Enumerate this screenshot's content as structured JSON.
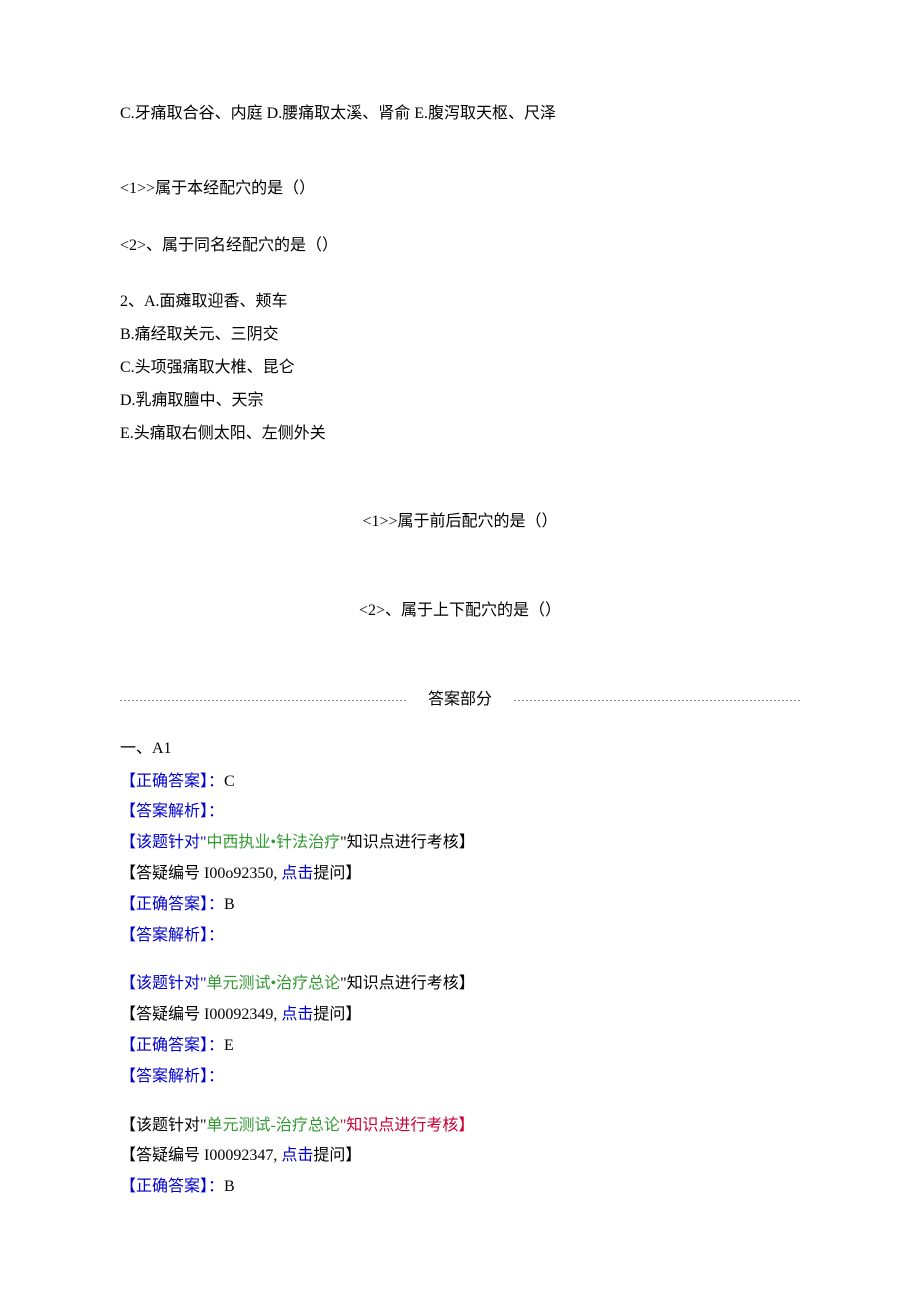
{
  "q1": {
    "optionCD_E": "C.牙痛取合谷、内庭 D.腰痛取太溪、肾俞 E.腹泻取天枢、尺泽",
    "sub1": "<1>>属于本经配穴的是（）",
    "sub2": "<2>、属于同名经配穴的是（）"
  },
  "q2": {
    "label": "2、A.面瘫取迎香、颊车",
    "optB": "B.痛经取关元、三阴交",
    "optC": "C.头项强痛取大椎、昆仑",
    "optD": "D.乳痈取膻中、天宗",
    "optE": "E.头痛取右侧太阳、左侧外关",
    "sub1": "<1>>属于前后配穴的是（）",
    "sub2": "<2>、属于上下配穴的是（）"
  },
  "answerHeader": "答案部分",
  "sectionLabel": "一、A1",
  "labels": {
    "correct_open": "【正确答案】：",
    "analysis": "【答案解析】：",
    "topic_open": "【该题针对\"",
    "topic_close": "\"知识点进行考核】",
    "qnum_open": "【答疑编号 ",
    "qnum_mid": ", ",
    "qnum_close": "提问】",
    "click": "点击"
  },
  "answers": [
    {
      "correct": "C",
      "topic": "中西执业•针法治疗",
      "qnum": "I00o92350",
      "topic_prefix_black": false
    },
    {
      "correct": "B",
      "topic": "单元测试•治疗总论",
      "qnum": "I00092349",
      "topic_prefix_black": false
    },
    {
      "correct": "E",
      "topic": "单元测试-治疗总论",
      "qnum": "I00092347",
      "topic_prefix_black": true
    },
    {
      "correct": "B",
      "topic": "",
      "qnum": "",
      "topic_prefix_black": false,
      "partial": true
    }
  ]
}
